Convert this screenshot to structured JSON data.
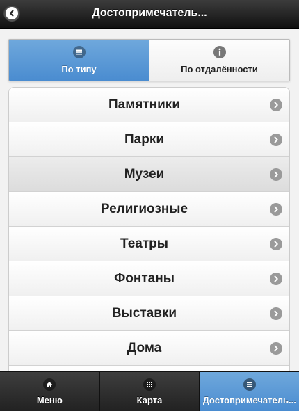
{
  "header": {
    "title": "Достопримечатель...",
    "back_icon": "chevron-left-icon"
  },
  "segmented": {
    "tabs": [
      {
        "label": "По типу",
        "icon": "list-icon",
        "active": true
      },
      {
        "label": "По отдалённости",
        "icon": "info-icon",
        "active": false
      }
    ]
  },
  "list": {
    "items": [
      {
        "label": "Памятники"
      },
      {
        "label": "Парки"
      },
      {
        "label": "Музеи"
      },
      {
        "label": "Религиозные"
      },
      {
        "label": "Театры"
      },
      {
        "label": "Фонтаны"
      },
      {
        "label": "Выставки"
      },
      {
        "label": "Дома"
      }
    ]
  },
  "navbar": {
    "items": [
      {
        "label": "Меню",
        "icon": "home-icon",
        "active": false
      },
      {
        "label": "Карта",
        "icon": "grid-icon",
        "active": false
      },
      {
        "label": "Достопримечатель...",
        "icon": "list-icon",
        "active": true
      }
    ]
  },
  "colors": {
    "accent": "#5b9bd5",
    "header_bg": "#1a1a1a",
    "navbar_bg": "#2a2a2a"
  }
}
